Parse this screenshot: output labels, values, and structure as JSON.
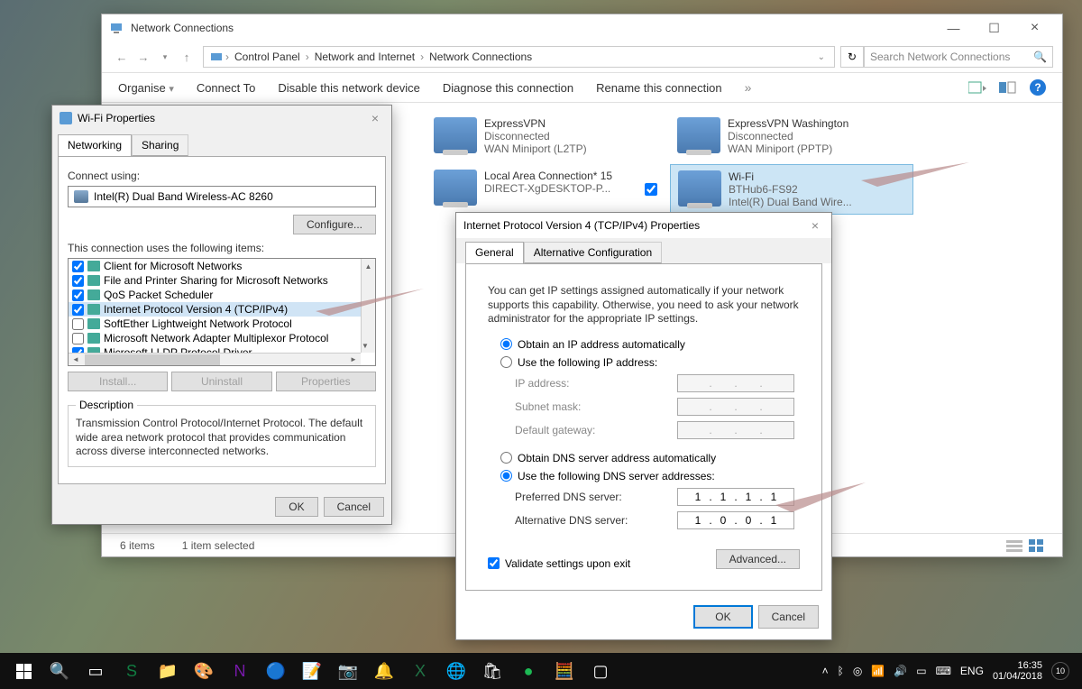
{
  "mainWindow": {
    "title": "Network Connections",
    "breadcrumb": [
      "Control Panel",
      "Network and Internet",
      "Network Connections"
    ],
    "searchPlaceholder": "Search Network Connections",
    "menu": {
      "organise": "Organise",
      "connectTo": "Connect To",
      "disable": "Disable this network device",
      "diagnose": "Diagnose this connection",
      "rename": "Rename this connection"
    },
    "connections": [
      {
        "name": "ExpressVPN",
        "status": "Disconnected",
        "sub": "WAN Miniport (L2TP)"
      },
      {
        "name": "ExpressVPN Washington",
        "status": "Disconnected",
        "sub": "WAN Miniport (PPTP)"
      },
      {
        "name": "Local Area Connection* 15",
        "status": "",
        "sub": "DIRECT-XgDESKTOP-P..."
      },
      {
        "name": "Wi-Fi",
        "status": "BTHub6-FS92",
        "sub": "Intel(R) Dual Band Wire..."
      }
    ],
    "status": {
      "items": "6 items",
      "selected": "1 item selected"
    }
  },
  "wifiProps": {
    "title": "Wi-Fi Properties",
    "tabs": {
      "networking": "Networking",
      "sharing": "Sharing"
    },
    "connectUsing": "Connect using:",
    "adapter": "Intel(R) Dual Band Wireless-AC 8260",
    "configure": "Configure...",
    "itemsLabel": "This connection uses the following items:",
    "items": [
      {
        "checked": true,
        "label": "Client for Microsoft Networks"
      },
      {
        "checked": true,
        "label": "File and Printer Sharing for Microsoft Networks"
      },
      {
        "checked": true,
        "label": "QoS Packet Scheduler"
      },
      {
        "checked": true,
        "label": "Internet Protocol Version 4 (TCP/IPv4)",
        "selected": true
      },
      {
        "checked": false,
        "label": "SoftEther Lightweight Network Protocol"
      },
      {
        "checked": false,
        "label": "Microsoft Network Adapter Multiplexor Protocol"
      },
      {
        "checked": true,
        "label": "Microsoft LLDP Protocol Driver"
      }
    ],
    "install": "Install...",
    "uninstall": "Uninstall",
    "properties": "Properties",
    "descriptionLegend": "Description",
    "description": "Transmission Control Protocol/Internet Protocol. The default wide area network protocol that provides communication across diverse interconnected networks.",
    "ok": "OK",
    "cancel": "Cancel"
  },
  "ipv4": {
    "title": "Internet Protocol Version 4 (TCP/IPv4) Properties",
    "tabs": {
      "general": "General",
      "alt": "Alternative Configuration"
    },
    "info": "You can get IP settings assigned automatically if your network supports this capability. Otherwise, you need to ask your network administrator for the appropriate IP settings.",
    "obtainIP": "Obtain an IP address automatically",
    "useIP": "Use the following IP address:",
    "ipAddress": "IP address:",
    "subnet": "Subnet mask:",
    "gateway": "Default gateway:",
    "obtainDNS": "Obtain DNS server address automatically",
    "useDNS": "Use the following DNS server addresses:",
    "preferred": "Preferred DNS server:",
    "alternative": "Alternative DNS server:",
    "dns1": [
      "1",
      "1",
      "1",
      "1"
    ],
    "dns2": [
      "1",
      "0",
      "0",
      "1"
    ],
    "validate": "Validate settings upon exit",
    "advanced": "Advanced...",
    "ok": "OK",
    "cancel": "Cancel"
  },
  "taskbar": {
    "lang": "ENG",
    "time": "16:35",
    "date": "01/04/2018",
    "notif": "10"
  }
}
